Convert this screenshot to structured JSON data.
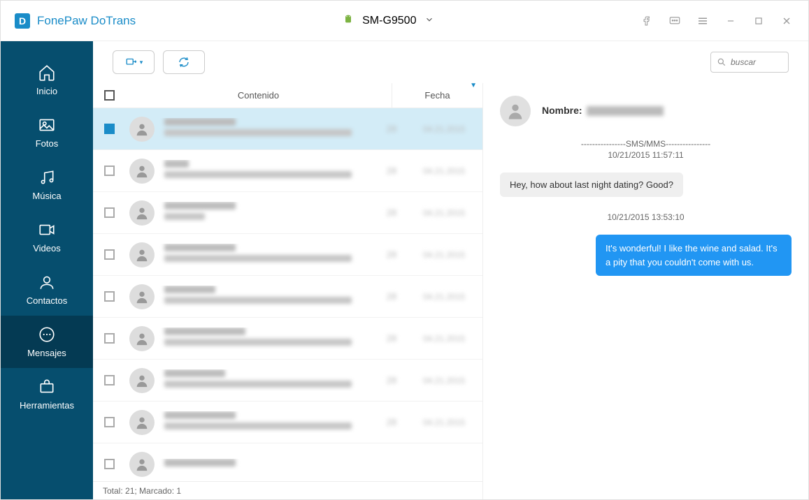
{
  "app": {
    "title": "FonePaw DoTrans"
  },
  "device": {
    "name": "SM-G9500"
  },
  "sidebar": {
    "items": [
      {
        "label": "Inicio"
      },
      {
        "label": "Fotos"
      },
      {
        "label": "Música"
      },
      {
        "label": "Videos"
      },
      {
        "label": "Contactos"
      },
      {
        "label": "Mensajes"
      },
      {
        "label": "Herramientas"
      }
    ]
  },
  "search": {
    "placeholder": "buscar"
  },
  "columns": {
    "content": "Contenido",
    "date": "Fecha"
  },
  "status": {
    "text": "Total: 21; Marcado: 1"
  },
  "detail": {
    "name_label": "Nombre:",
    "divider": "----------------SMS/MMS----------------",
    "ts1": "10/21/2015 11:57:11",
    "msg_in": "Hey, how about last night dating? Good?",
    "ts2": "10/21/2015 13:53:10",
    "msg_out": "It's wonderful! I like the wine and salad. It's a pity that you couldn't come with us."
  }
}
